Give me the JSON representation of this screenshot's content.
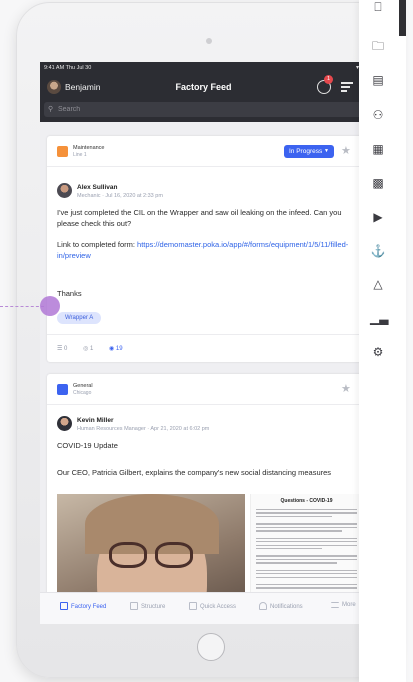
{
  "header": {
    "status_time": "9:41 AM  Thu Jul 30",
    "user_name": "Benjamin",
    "title": "Factory Feed",
    "notification_count": "1",
    "search_placeholder": "Search"
  },
  "posts": [
    {
      "category": "Maintenance",
      "subcategory": "Line 1",
      "status": "In Progress",
      "author": "Alex Sullivan",
      "meta": "Mechanic · Jul 16, 2020 at 2:33 pm",
      "body": "I've just completed the CIL on the Wrapper and saw oil leaking on the infeed. Can you please check this out?",
      "link_prefix": "Link to completed form: ",
      "link_text": "https://demomaster.poka.io/app/#/forms/equipment/1/5/11/filled-in/preview",
      "closing": "Thanks",
      "tag": "Wrapper A",
      "comments": "0",
      "shares": "1",
      "views": "19"
    },
    {
      "category": "General",
      "subcategory": "Chicago",
      "author": "Kevin Miller",
      "meta": "Human Resources Manager · Apr 21, 2020 at 6:02 pm",
      "headline": "COVID-19 Update",
      "body": "Our CEO, Patricia Gilbert, explains the company's new social distancing measures",
      "doc_title": "Questions - COVID-19"
    }
  ],
  "tabs": [
    {
      "label": "Factory Feed",
      "active": true
    },
    {
      "label": "Structure"
    },
    {
      "label": "Quick Access"
    },
    {
      "label": "Notifications"
    },
    {
      "label": "More"
    }
  ],
  "rail_icons": [
    "door-icon",
    "folder-icon",
    "robot-icon",
    "people-group-icon",
    "calendar-people-icon",
    "gallery-icon",
    "play-icon",
    "team-icon",
    "graduation-cap-icon",
    "bar-chart-icon",
    "gear-icon"
  ],
  "colors": {
    "accent": "#3c63f0",
    "header_bg": "#2c2d33",
    "maintenance": "#f5913a",
    "general": "#3c63f0",
    "pointer": "#b078d6"
  }
}
